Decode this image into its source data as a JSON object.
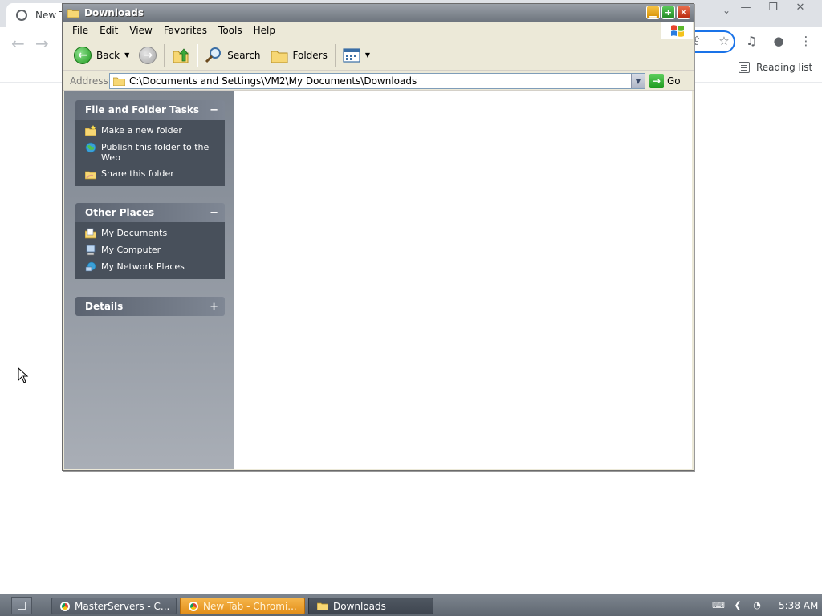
{
  "chrome": {
    "tab_title": "New T",
    "reading_list_label": "Reading list"
  },
  "explorer": {
    "title": "Downloads",
    "menu": [
      "File",
      "Edit",
      "View",
      "Favorites",
      "Tools",
      "Help"
    ],
    "toolbar": {
      "back_label": "Back",
      "search_label": "Search",
      "folders_label": "Folders"
    },
    "address": {
      "label": "Address",
      "value": "C:\\Documents and Settings\\VM2\\My Documents\\Downloads",
      "go_label": "Go"
    },
    "panels": {
      "file_tasks": {
        "title": "File and Folder Tasks",
        "toggle": "−",
        "items": [
          "Make a new folder",
          "Publish this folder to the Web",
          "Share this folder"
        ]
      },
      "other_places": {
        "title": "Other Places",
        "toggle": "−",
        "items": [
          "My Documents",
          "My Computer",
          "My Network Places"
        ]
      },
      "details": {
        "title": "Details",
        "toggle": "+"
      }
    }
  },
  "taskbar": {
    "items": [
      "MasterServers - C...",
      "New Tab - Chromi...",
      "Downloads"
    ],
    "clock": "5:38 AM"
  }
}
